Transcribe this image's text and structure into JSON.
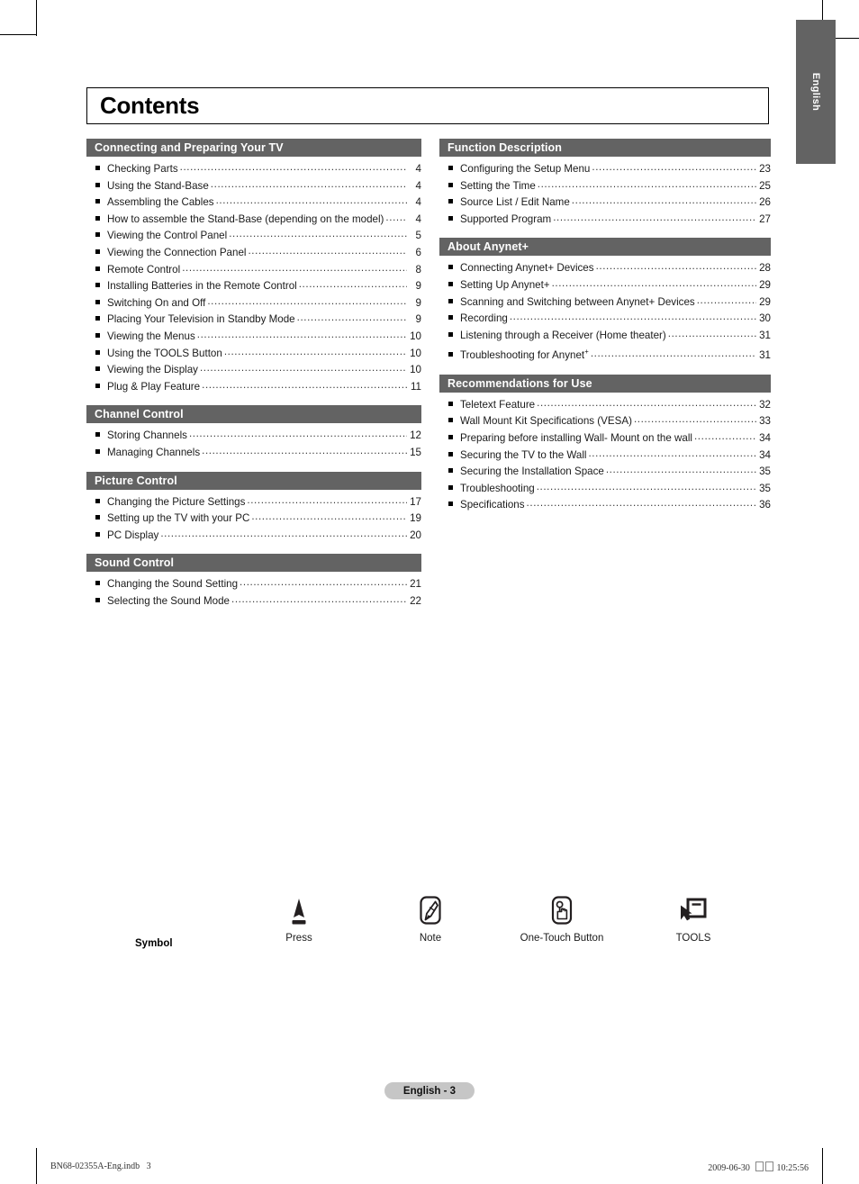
{
  "page": {
    "title": "Contents",
    "side_tab_label": "English",
    "footer_label": "English - 3",
    "print_mark_left": "BN68-02355A-Eng.indb   3",
    "print_mark_right_date": "2009-06-30",
    "print_mark_right_time": "10:25:56"
  },
  "columns": {
    "left": [
      {
        "header": "Connecting and Preparing Your TV",
        "entries": [
          {
            "label": "Checking Parts",
            "page": "4"
          },
          {
            "label": "Using the Stand-Base",
            "page": "4"
          },
          {
            "label": "Assembling the Cables",
            "page": "4"
          },
          {
            "label": "How to assemble the Stand-Base (depending on the model)",
            "page": "4"
          },
          {
            "label": "Viewing the Control Panel",
            "page": "5"
          },
          {
            "label": "Viewing the Connection Panel",
            "page": "6"
          },
          {
            "label": "Remote Control",
            "page": "8"
          },
          {
            "label": "Installing Batteries in the Remote Control",
            "page": "9"
          },
          {
            "label": "Switching On and Off",
            "page": "9"
          },
          {
            "label": "Placing Your Television in Standby Mode",
            "page": "9"
          },
          {
            "label": "Viewing the Menus",
            "page": "10"
          },
          {
            "label": "Using the TOOLS Button",
            "page": "10"
          },
          {
            "label": "Viewing the Display",
            "page": "10"
          },
          {
            "label": "Plug & Play Feature",
            "page": "11"
          }
        ]
      },
      {
        "header": "Channel Control",
        "entries": [
          {
            "label": "Storing Channels",
            "page": "12"
          },
          {
            "label": "Managing Channels",
            "page": "15"
          }
        ]
      },
      {
        "header": "Picture Control",
        "entries": [
          {
            "label": "Changing the Picture Settings",
            "page": "17"
          },
          {
            "label": "Setting up the TV with your PC",
            "page": "19"
          },
          {
            "label": "PC Display",
            "page": "20"
          }
        ]
      },
      {
        "header": "Sound Control",
        "entries": [
          {
            "label": "Changing the Sound Setting",
            "page": "21"
          },
          {
            "label": "Selecting the Sound Mode",
            "page": "22"
          }
        ]
      }
    ],
    "right": [
      {
        "header": "Function Description",
        "entries": [
          {
            "label": "Configuring the Setup Menu",
            "page": "23"
          },
          {
            "label": "Setting the Time",
            "page": "25"
          },
          {
            "label": "Source List / Edit Name",
            "page": "26"
          },
          {
            "label": "Supported Program",
            "page": "27"
          }
        ]
      },
      {
        "header": "About Anynet+",
        "entries": [
          {
            "label": "Connecting Anynet+ Devices",
            "page": "28"
          },
          {
            "label": "Setting Up Anynet+",
            "page": "29"
          },
          {
            "label": "Scanning and Switching between Anynet+ Devices",
            "page": "29"
          },
          {
            "label": "Recording",
            "page": "30"
          },
          {
            "label": "Listening through a Receiver (Home theater)",
            "page": "31"
          },
          {
            "label": "Troubleshooting for Anynet",
            "label_sup": "+",
            "page": "31"
          }
        ]
      },
      {
        "header": "Recommendations for Use",
        "entries": [
          {
            "label": "Teletext Feature",
            "page": "32"
          },
          {
            "label": "Wall Mount Kit Specifications (VESA)",
            "page": "33"
          },
          {
            "label": "Preparing before installing Wall- Mount on the wall",
            "page": "34"
          },
          {
            "label": "Securing the TV to the Wall",
            "page": "34"
          },
          {
            "label": "Securing the Installation Space",
            "page": "35"
          },
          {
            "label": "Troubleshooting",
            "page": "35"
          },
          {
            "label": "Specifications",
            "page": "36"
          }
        ]
      }
    ]
  },
  "legend": {
    "title": "Symbol",
    "items": [
      {
        "icon": "press-icon",
        "caption": "Press"
      },
      {
        "icon": "note-pencil-icon",
        "caption": "Note"
      },
      {
        "icon": "one-touch-button-icon",
        "caption": "One-Touch Button"
      },
      {
        "icon": "tools-icon",
        "caption": "TOOLS"
      }
    ]
  },
  "colors": {
    "header_bar": "#636363",
    "footer_pill": "#c6c6c6",
    "text": "#1a1a1a"
  }
}
